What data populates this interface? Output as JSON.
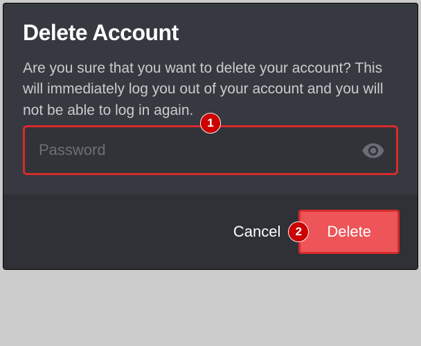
{
  "modal": {
    "title": "Delete Account",
    "warning": "Are you sure that you want to delete your account? This will immediately log you out of your account and you will not be able to log in again.",
    "password_placeholder": "Password"
  },
  "buttons": {
    "cancel": "Cancel",
    "delete": "Delete"
  },
  "annotations": {
    "badge1": "1",
    "badge2": "2"
  },
  "colors": {
    "highlight": "#d92b2b",
    "danger_button": "#ed5558",
    "modal_bg": "#36393f",
    "footer_bg": "#2f3136"
  }
}
